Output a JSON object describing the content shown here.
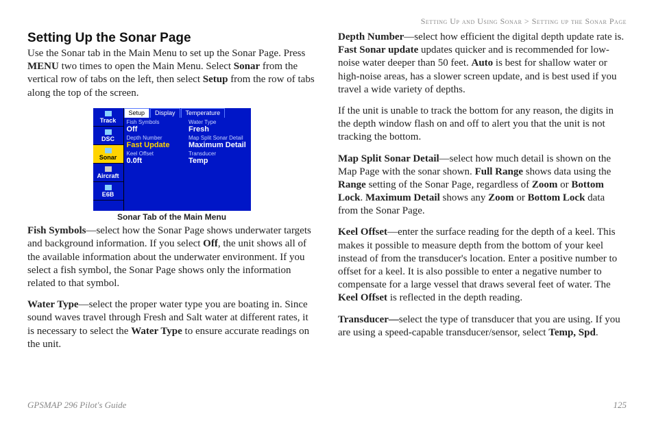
{
  "header": {
    "left": "Setting Up and Using Sonar",
    "sep": ">",
    "right": "Setting up the Sonar Page"
  },
  "left": {
    "heading": "Setting Up the Sonar Page",
    "intro_segments": [
      {
        "t": "Use the Sonar tab in the Main Menu to set up the Sonar Page. Press ",
        "b": false
      },
      {
        "t": "MENU",
        "b": true
      },
      {
        "t": " two times to open the Main Menu. Select ",
        "b": false
      },
      {
        "t": "Sonar",
        "b": true
      },
      {
        "t": " from the vertical row of tabs on the left, then select ",
        "b": false
      },
      {
        "t": "Setup",
        "b": true
      },
      {
        "t": " from the row of tabs along the top of the screen.",
        "b": false
      }
    ],
    "figure": {
      "caption": "Sonar Tab of the Main Menu",
      "side_tabs": [
        "Track",
        "DSC",
        "Sonar",
        "Aircraft",
        "E6B"
      ],
      "side_selected_index": 2,
      "top_tabs": [
        "Setup",
        "Display",
        "Temperature"
      ],
      "top_selected_index": 0,
      "fields": [
        {
          "label": "Fish Symbols",
          "value": "Off",
          "hl": false
        },
        {
          "label": "Water Type",
          "value": "Fresh",
          "hl": false
        },
        {
          "label": "Depth Number",
          "value": "Fast Update",
          "hl": true
        },
        {
          "label": "Map Split Sonar Detail",
          "value": "Maximum Detail",
          "hl": false
        },
        {
          "label": "Keel Offset",
          "value": "0.0ft",
          "hl": false
        },
        {
          "label": "Transducer",
          "value": "Temp",
          "hl": false
        }
      ]
    },
    "p_fish": [
      {
        "t": "Fish Symbols",
        "b": true
      },
      {
        "t": "—select how the Sonar Page shows underwater targets and background information. If you select ",
        "b": false
      },
      {
        "t": "Off",
        "b": true
      },
      {
        "t": ", the unit shows all of the available information about the underwater environment. If you select a fish symbol, the Sonar Page shows only the information related to that symbol.",
        "b": false
      }
    ],
    "p_water": [
      {
        "t": "Water Type",
        "b": true
      },
      {
        "t": "—select the proper water type you are boating in. Since sound waves travel through Fresh and Salt water at different rates, it is necessary to select the ",
        "b": false
      },
      {
        "t": "Water Type",
        "b": true
      },
      {
        "t": " to ensure accurate readings on the unit.",
        "b": false
      }
    ]
  },
  "right": {
    "p_depth": [
      {
        "t": "Depth Number",
        "b": true
      },
      {
        "t": "—select how efficient the digital depth update rate is. ",
        "b": false
      },
      {
        "t": "Fast Sonar update",
        "b": true
      },
      {
        "t": " updates quicker and is recommended for low-noise water deeper than 50 feet. ",
        "b": false
      },
      {
        "t": "Auto",
        "b": true
      },
      {
        "t": " is best for shallow water or high-noise areas, has a slower screen update, and is best used if you travel a wide variety of depths.",
        "b": false
      }
    ],
    "p_track": [
      {
        "t": "If the unit is unable to track the bottom for any reason, the digits in the depth window flash on and off to alert you that the unit is not tracking the bottom.",
        "b": false
      }
    ],
    "p_mapsplit": [
      {
        "t": "Map Split Sonar Detail",
        "b": true
      },
      {
        "t": "—select how much detail is shown on the Map Page with the sonar shown. ",
        "b": false
      },
      {
        "t": "Full Range",
        "b": true
      },
      {
        "t": " shows data using the ",
        "b": false
      },
      {
        "t": "Range",
        "b": true
      },
      {
        "t": " setting of the Sonar Page, regardless of ",
        "b": false
      },
      {
        "t": "Zoom",
        "b": true
      },
      {
        "t": " or ",
        "b": false
      },
      {
        "t": "Bottom Lock",
        "b": true
      },
      {
        "t": ". ",
        "b": false
      },
      {
        "t": "Maximum Detail",
        "b": true
      },
      {
        "t": " shows any ",
        "b": false
      },
      {
        "t": "Zoom",
        "b": true
      },
      {
        "t": " or ",
        "b": false
      },
      {
        "t": "Bottom Lock",
        "b": true
      },
      {
        "t": " data from the Sonar Page.",
        "b": false
      }
    ],
    "p_keel": [
      {
        "t": "Keel Offset",
        "b": true
      },
      {
        "t": "—enter the surface reading for the depth of a keel. This makes it possible to measure depth from the bottom of your keel instead of from the transducer's location. Enter a positive number to offset for a keel. It is also possible to enter a negative number to compensate for a large vessel that draws several feet of water. The ",
        "b": false
      },
      {
        "t": "Keel Offset",
        "b": true
      },
      {
        "t": " is reflected in the depth reading.",
        "b": false
      }
    ],
    "p_transducer": [
      {
        "t": "Transducer—",
        "b": true
      },
      {
        "t": "select the type of transducer that you are using. If you are using a speed-capable transducer/sensor, select ",
        "b": false
      },
      {
        "t": "Temp, Spd",
        "b": true
      },
      {
        "t": ".",
        "b": false
      }
    ]
  },
  "footer": {
    "left": "GPSMAP 296 Pilot's Guide",
    "right": "125"
  }
}
